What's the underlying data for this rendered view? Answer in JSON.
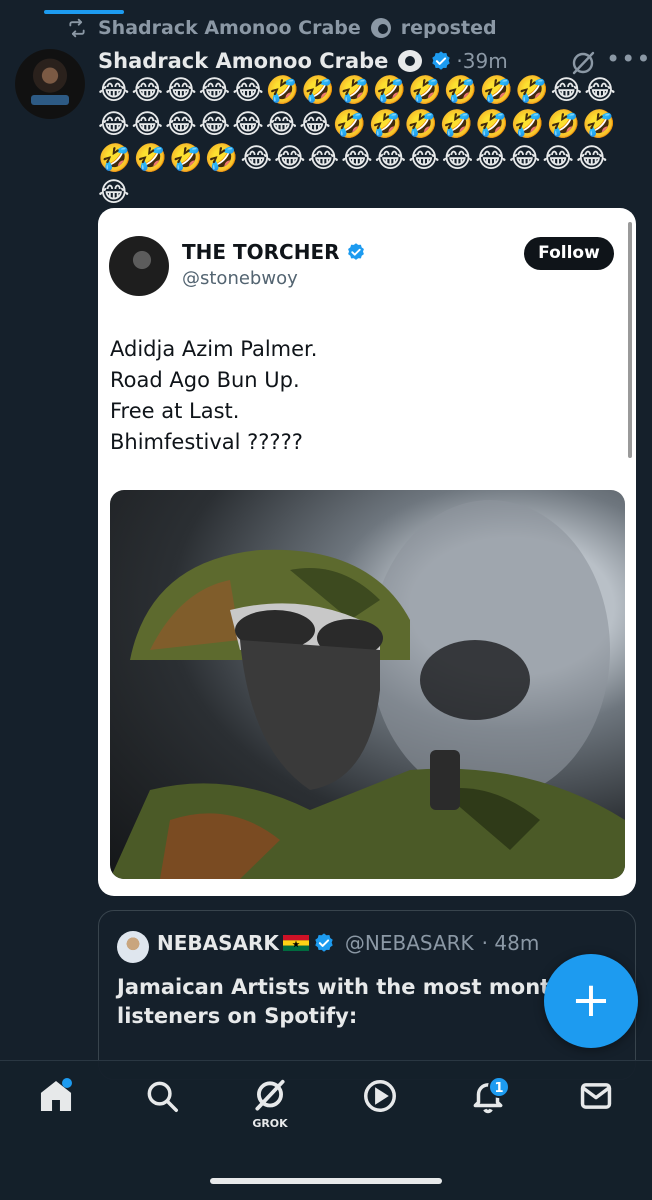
{
  "repost": {
    "label": "Shadrack Amonoo Crabe",
    "suffix": "reposted"
  },
  "post": {
    "author": "Shadrack Amonoo Crabe",
    "time": "·39m",
    "text": "😂😂😂😂😂🤣🤣🤣🤣🤣🤣🤣🤣😂😂😂😂😂😂😂😂😂🤣🤣🤣🤣🤣🤣🤣🤣🤣🤣🤣🤣😂😂😂😂😂😂😂😂😂😂😂😂"
  },
  "quote": {
    "name": "THE TORCHER",
    "handle": "@stonebwoy",
    "follow_label": "Follow",
    "lines": [
      "Adidja Azim Palmer.",
      "Road Ago Bun Up.",
      "Free at Last.",
      "Bhimfestival ?????"
    ]
  },
  "next_post": {
    "name": "NEBASARK",
    "handle": "@NEBASARK",
    "time": "· 48m",
    "text": "Jamaican Artists with the most monthly listeners on Spotify:"
  },
  "fab": {
    "label": "+"
  },
  "nav": {
    "grok_label": "GROK",
    "notifications_count": "1"
  },
  "colors": {
    "background": "#15202b",
    "accent": "#1d9bf0",
    "secondary_text": "#8b98a5"
  }
}
